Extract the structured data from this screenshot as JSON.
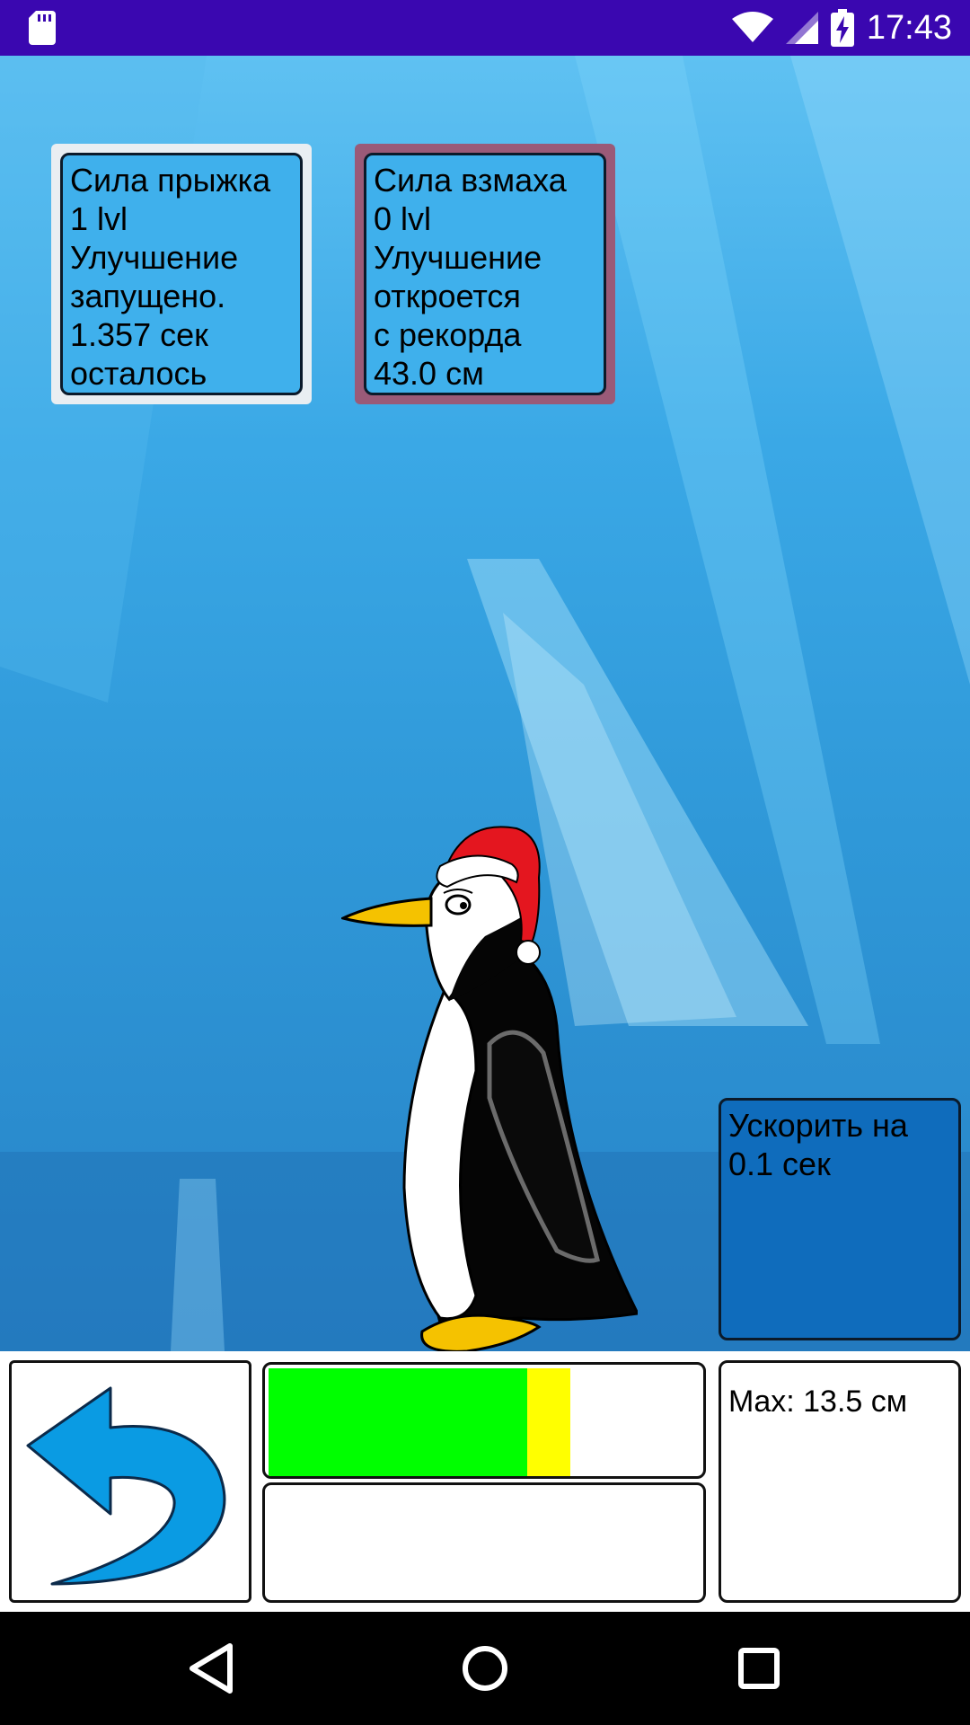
{
  "status_bar": {
    "time": "17:43"
  },
  "upgrades": {
    "jump": {
      "lines": [
        "Сила прыжка",
        "1 lvl",
        "Улучшение",
        "запущено.",
        "1.357 сек",
        "осталось"
      ]
    },
    "flap": {
      "lines": [
        "Сила взмаха",
        "0 lvl",
        "Улучшение",
        "откроется",
        "с рекорда",
        "43.0 см"
      ]
    }
  },
  "speedup": {
    "lines": [
      "Ускорить на",
      "0.1 сек"
    ]
  },
  "power_bar": {
    "green_fraction": 0.6,
    "yellow_fraction": 0.7
  },
  "max": {
    "label": "Max: 13.5 см"
  },
  "colors": {
    "status_bar": "#3a07b0",
    "bar_green": "#00ff00",
    "bar_yellow": "#ffff00",
    "back_arrow": "#0a9be3"
  },
  "icons": {
    "back": "back-arrow-icon",
    "nav_back": "triangle-back-icon",
    "nav_home": "circle-home-icon",
    "nav_recents": "square-recents-icon"
  }
}
